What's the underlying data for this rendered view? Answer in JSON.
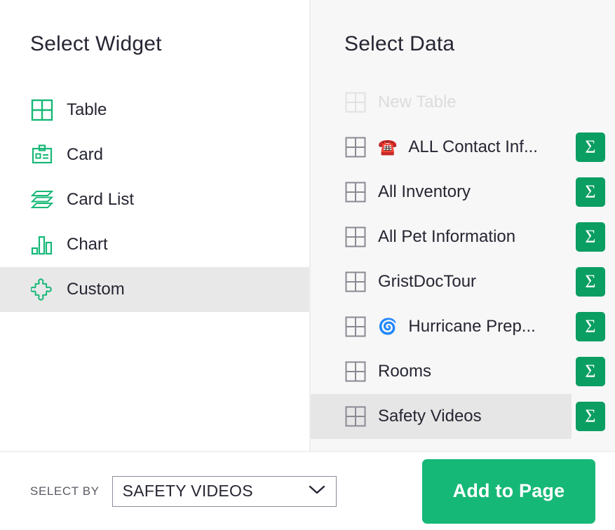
{
  "widget_panel": {
    "title": "Select Widget",
    "items": [
      {
        "label": "Table",
        "icon": "table-grid-icon",
        "selected": false
      },
      {
        "label": "Card",
        "icon": "card-icon",
        "selected": false
      },
      {
        "label": "Card List",
        "icon": "card-list-icon",
        "selected": false
      },
      {
        "label": "Chart",
        "icon": "bar-chart-icon",
        "selected": false
      },
      {
        "label": "Custom",
        "icon": "puzzle-piece-icon",
        "selected": true
      }
    ]
  },
  "data_panel": {
    "title": "Select Data",
    "summary_button_label": "Σ",
    "items": [
      {
        "label": "New Table",
        "emoji": "",
        "icon": "table-grid-icon",
        "disabled": true,
        "selected": false,
        "has_summary": false
      },
      {
        "label": "ALL Contact Inf...",
        "emoji": "☎️",
        "icon": "table-grid-icon",
        "disabled": false,
        "selected": false,
        "has_summary": true
      },
      {
        "label": "All Inventory",
        "emoji": "",
        "icon": "table-grid-icon",
        "disabled": false,
        "selected": false,
        "has_summary": true
      },
      {
        "label": "All Pet Information",
        "emoji": "",
        "icon": "table-grid-icon",
        "disabled": false,
        "selected": false,
        "has_summary": true
      },
      {
        "label": "GristDocTour",
        "emoji": "",
        "icon": "table-grid-icon",
        "disabled": false,
        "selected": false,
        "has_summary": true
      },
      {
        "label": "Hurricane Prep...",
        "emoji": "🌀",
        "icon": "table-grid-icon",
        "disabled": false,
        "selected": false,
        "has_summary": true
      },
      {
        "label": "Rooms",
        "emoji": "",
        "icon": "table-grid-icon",
        "disabled": false,
        "selected": false,
        "has_summary": true
      },
      {
        "label": "Safety Videos",
        "emoji": "",
        "icon": "table-grid-icon",
        "disabled": false,
        "selected": true,
        "has_summary": true
      }
    ]
  },
  "footer": {
    "select_by_label": "SELECT BY",
    "select_by_value": "SAFETY VIDEOS",
    "add_button_label": "Add to Page"
  },
  "colors": {
    "accent_green": "#16b877",
    "summary_green": "#0a9e62",
    "panel_background": "#f7f7f7",
    "selected_row": "#e6e6e6",
    "text": "#262633",
    "disabled_text": "#dcdcdc"
  }
}
